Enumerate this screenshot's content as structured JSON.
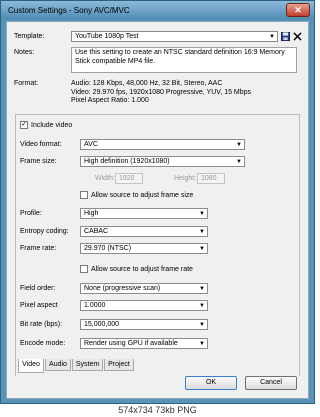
{
  "window": {
    "title": "Custom Settings - Sony AVC/MVC",
    "close_label": "✕"
  },
  "template": {
    "label": "Template:",
    "value": "YouTube 1080p Test"
  },
  "notes": {
    "label": "Notes:",
    "text": "Use this setting to create an NTSC standard definition 16:9 Memory Stick compatible MP4 file."
  },
  "format": {
    "label": "Format:",
    "lines": [
      "Audio: 128 Kbps, 48,000 Hz, 32 Bit, Stereo, AAC",
      "Video: 29.970 fps, 1920x1080 Progressive, YUV, 15 Mbps",
      "Pixel Aspect Ratio: 1.000"
    ]
  },
  "video": {
    "include_label": "Include video",
    "include_checked": true,
    "video_format_label": "Video format:",
    "video_format_value": "AVC",
    "frame_size_label": "Frame size:",
    "frame_size_value": "High definition (1920x1080)",
    "width_label": "Width:",
    "width_value": "1920",
    "height_label": "Height:",
    "height_value": "1080",
    "adjust_frame_size_label": "Allow source to adjust frame size",
    "profile_label": "Profile:",
    "profile_value": "High",
    "entropy_label": "Entropy coding:",
    "entropy_value": "CABAC",
    "frame_rate_label": "Frame rate:",
    "frame_rate_value": "29.970 (NTSC)",
    "adjust_frame_rate_label": "Allow source to adjust frame rate",
    "field_order_label": "Field order:",
    "field_order_value": "None (progressive scan)",
    "pixel_aspect_label": "Pixel aspect",
    "pixel_aspect_value": "1.0000",
    "bit_rate_label": "Bit rate (bps):",
    "bit_rate_value": "15,000,000",
    "encode_mode_label": "Encode mode:",
    "encode_mode_value": "Render using GPU if available"
  },
  "tabs": [
    "Video",
    "Audio",
    "System",
    "Project"
  ],
  "buttons": {
    "ok": "OK",
    "cancel": "Cancel"
  },
  "footer": "574x734  73kb  PNG"
}
